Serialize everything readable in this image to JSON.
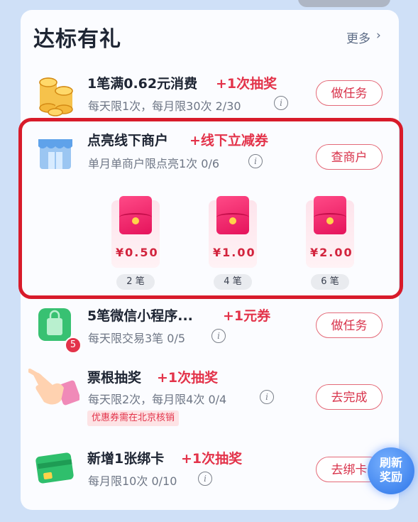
{
  "section": {
    "title": "达标有礼",
    "more": "更多",
    "more_arrow": "›"
  },
  "tasks": [
    {
      "title": "1笔满0.62元消费",
      "reward": "+1次抽奖",
      "sub": "每天限1次，每月限30次 2/30",
      "button": "做任务",
      "icon": "gold-coins-icon"
    },
    {
      "title": "点亮线下商户",
      "reward": "+线下立减券",
      "sub": "单月单商户限点亮1次 0/6",
      "button": "查商户",
      "icon": "storefront-icon",
      "tiers": [
        {
          "amount": "¥0.50",
          "count": "2 笔"
        },
        {
          "amount": "¥1.00",
          "count": "4 笔"
        },
        {
          "amount": "¥2.00",
          "count": "6 笔"
        }
      ]
    },
    {
      "title": "5笔微信小程序...",
      "reward": "+1元券",
      "sub": "每天限交易3笔 0/5",
      "button": "做任务",
      "icon": "shopping-bag-icon",
      "badge": "5"
    },
    {
      "title": "票根抽奖",
      "reward": "+1次抽奖",
      "sub": "每天限2次，每月限4次 0/4",
      "button": "去完成",
      "icon": "pointing-hand-icon",
      "tag": "优惠券需在北京核销"
    },
    {
      "title": "新增1张绑卡",
      "reward": "+1次抽奖",
      "sub": "每月限10次 0/10",
      "button": "去绑卡",
      "icon": "bank-card-icon"
    }
  ],
  "info_glyph": "i",
  "refresh": {
    "line1": "刷新",
    "line2": "奖励"
  }
}
